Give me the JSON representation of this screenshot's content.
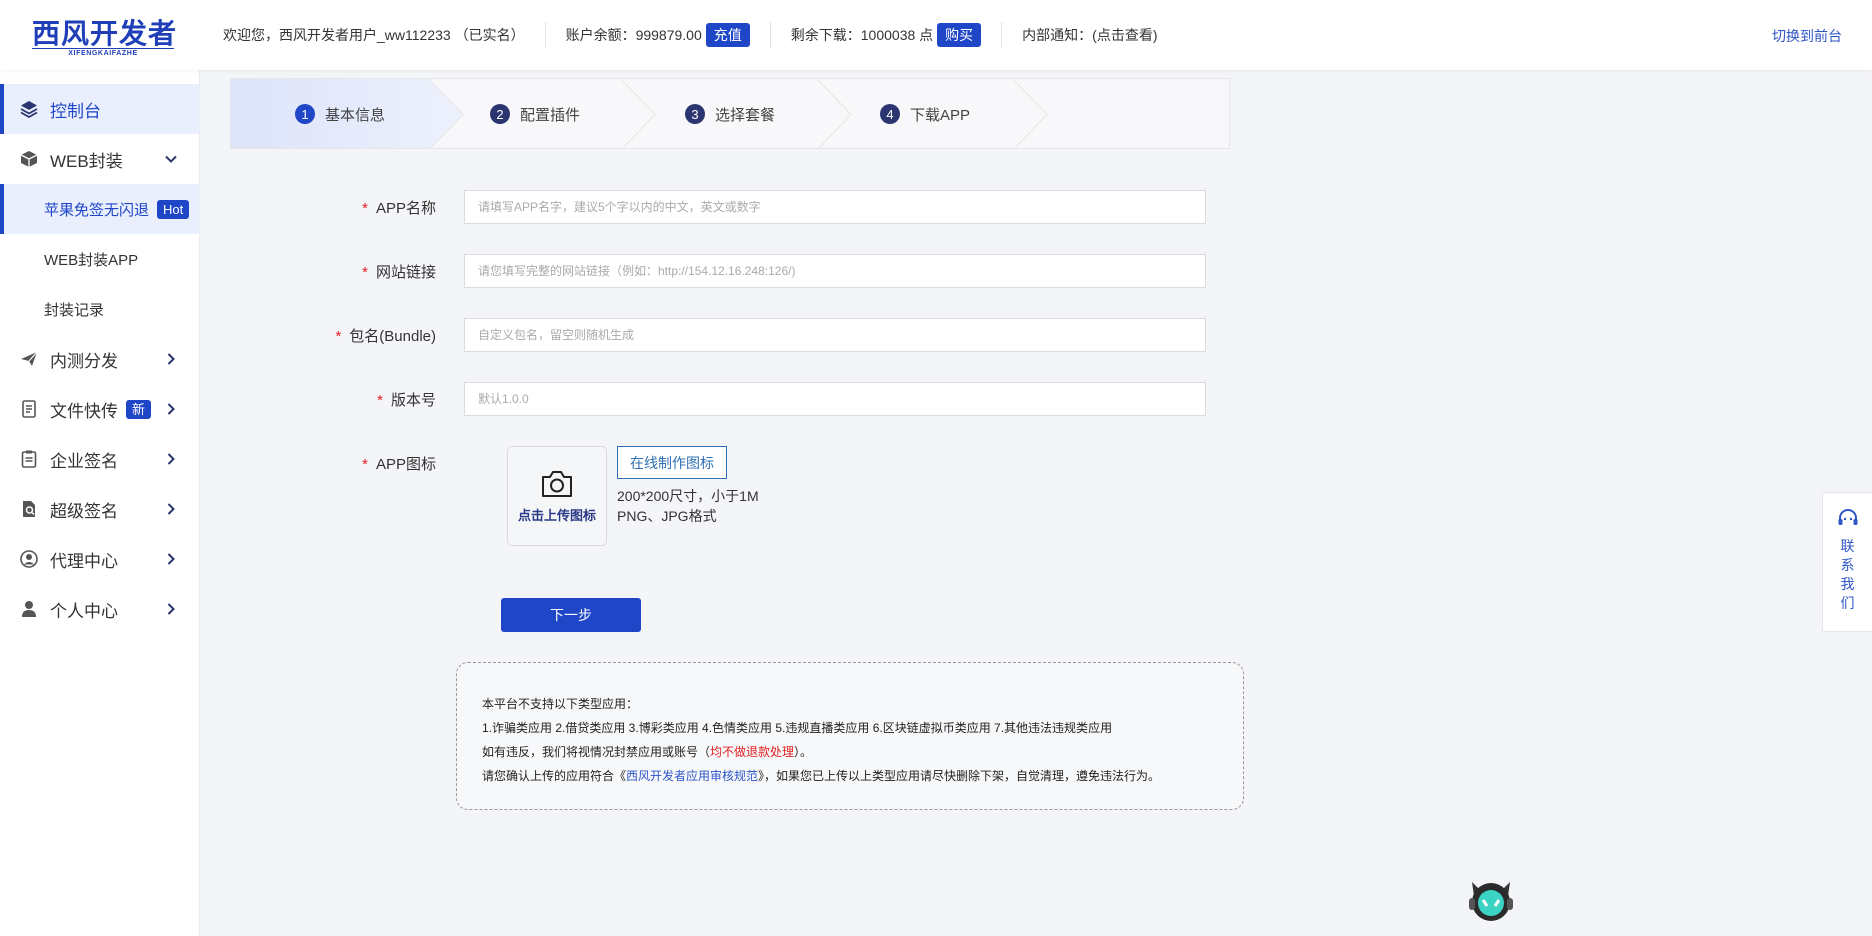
{
  "brand": {
    "logo_text": "西风开发者",
    "logo_sub": "XIFENGKAIFAZHE",
    "accent": "#2046c8"
  },
  "header": {
    "welcome": "欢迎您，西风开发者用户_ww112233 （已实名）",
    "balance_label": "账户余额：999879.00",
    "recharge_btn": "充值",
    "downloads_label": "剩余下载：1000038 点",
    "buy_btn": "购买",
    "notice": "内部通知：(点击查看)",
    "switch_front": "切换到前台"
  },
  "sidebar": {
    "items": [
      {
        "label": "控制台",
        "icon": "layers-icon"
      },
      {
        "label": "WEB封装",
        "icon": "box-icon"
      },
      {
        "label": "苹果免签无闪退",
        "badge": "Hot"
      },
      {
        "label": "WEB封装APP"
      },
      {
        "label": "封装记录"
      },
      {
        "label": "内测分发",
        "icon": "paper-plane-icon"
      },
      {
        "label": "文件快传",
        "icon": "file-transfer-icon",
        "badge": "新"
      },
      {
        "label": "企业签名",
        "icon": "clipboard-icon"
      },
      {
        "label": "超级签名",
        "icon": "document-search-icon"
      },
      {
        "label": "代理中心",
        "icon": "user-circle-icon"
      },
      {
        "label": "个人中心",
        "icon": "person-icon"
      }
    ]
  },
  "steps": [
    {
      "num": "1",
      "label": "基本信息"
    },
    {
      "num": "2",
      "label": "配置插件"
    },
    {
      "num": "3",
      "label": "选择套餐"
    },
    {
      "num": "4",
      "label": "下载APP"
    }
  ],
  "form": {
    "app_name": {
      "label": "APP名称",
      "required": "*",
      "placeholder": "请填写APP名字，建议5个字以内的中文，英文或数字"
    },
    "website": {
      "label": "网站链接",
      "required": "*",
      "placeholder": "请您填写完整的网站链接（例如：http://154.12.16.248:126/)"
    },
    "bundle": {
      "label": "包名(Bundle)",
      "required": "*",
      "placeholder": "自定义包名，留空则随机生成"
    },
    "version": {
      "label": "版本号",
      "required": "*",
      "placeholder": "默认1.0.0"
    },
    "icon": {
      "label": "APP图标",
      "required": "*",
      "upload_text": "点击上传图标",
      "online_btn": "在线制作图标",
      "hint_size": "200*200尺寸，小于1M",
      "hint_format": "PNG、JPG格式"
    },
    "next_btn": "下一步"
  },
  "notice": {
    "line1": "本平台不支持以下类型应用：",
    "line2": "1.诈骗类应用 2.借贷类应用 3.博彩类应用 4.色情类应用 5.违规直播类应用 6.区块链虚拟币类应用 7.其他违法违规类应用",
    "line3_pre": "如有违反，我们将视情况封禁应用或账号（",
    "line3_red": "均不做退款处理",
    "line3_post": "）。",
    "line4_pre": "请您确认上传的应用符合《",
    "line4_link": "西风开发者应用审核规范",
    "line4_post": "》，如果您已上传以上类型应用请尽快删除下架，自觉清理，遵免违法行为。"
  },
  "float": {
    "contact": "联系我们"
  }
}
